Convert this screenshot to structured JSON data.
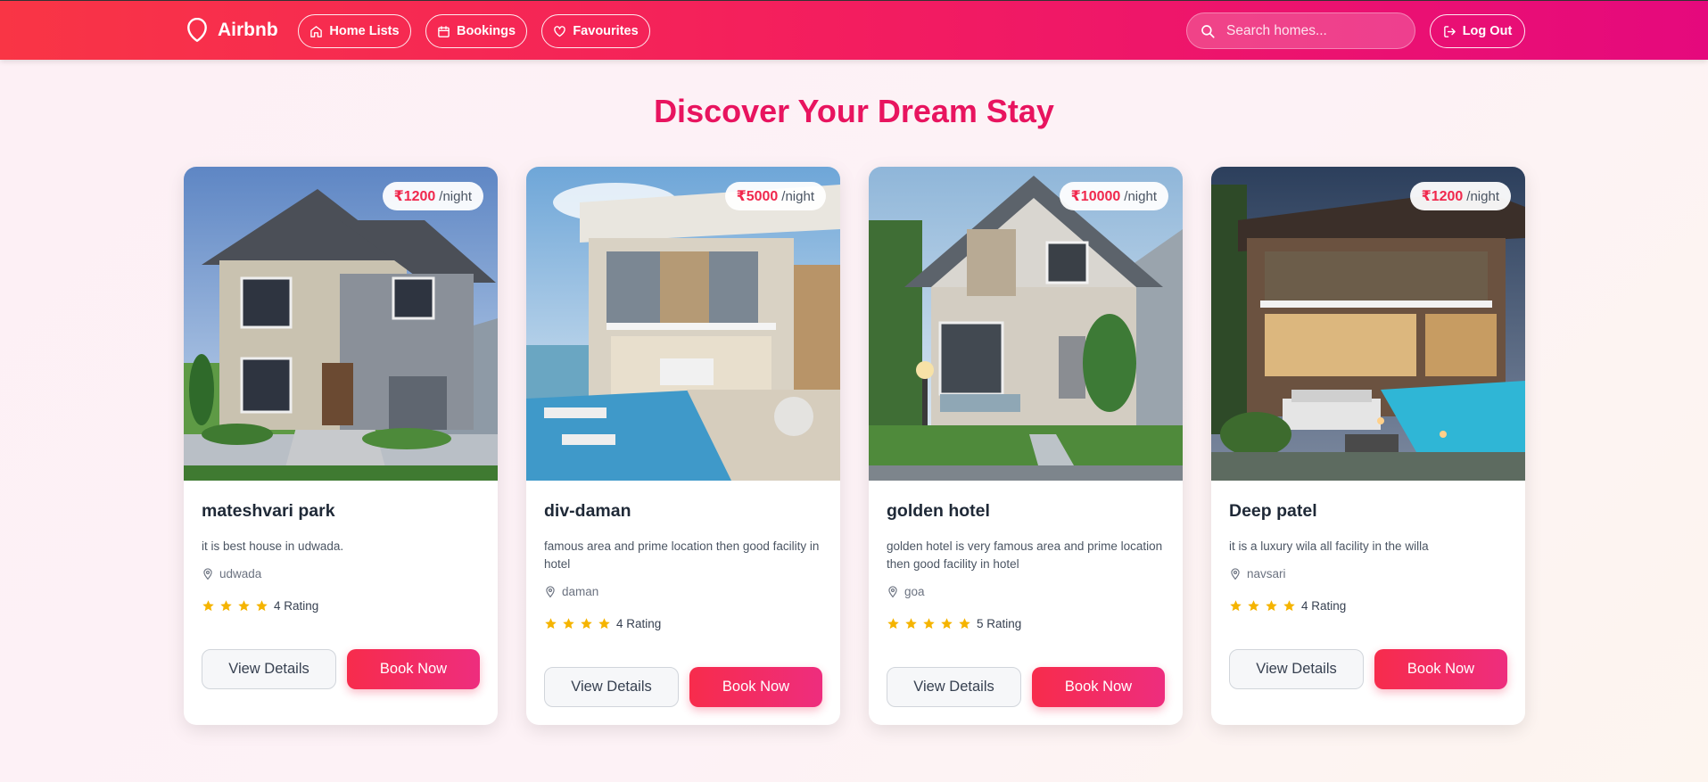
{
  "navbar": {
    "brand": "Airbnb",
    "home_lists": "Home Lists",
    "bookings": "Bookings",
    "favourites": "Favourites",
    "search_placeholder": "Search homes...",
    "logout": "Log Out"
  },
  "page_title": "Discover Your Dream Stay",
  "colors": {
    "accent": "#e8145f",
    "price": "#f0284d",
    "star": "#f5b400"
  },
  "cards": [
    {
      "price": "₹1200",
      "per": "/night",
      "title": "mateshvari park",
      "description": "it is best house in udwada.",
      "location": "udwada",
      "stars": 4,
      "rating_text": "4 Rating",
      "view": "View Details",
      "book": "Book Now"
    },
    {
      "price": "₹5000",
      "per": "/night",
      "title": "div-daman",
      "description": "famous area and prime location then good facility in hotel",
      "location": "daman",
      "stars": 4,
      "rating_text": "4 Rating",
      "view": "View Details",
      "book": "Book Now"
    },
    {
      "price": "₹10000",
      "per": "/night",
      "title": "golden hotel",
      "description": "golden hotel is very famous area and prime location then good facility in hotel",
      "location": "goa",
      "stars": 5,
      "rating_text": "5 Rating",
      "view": "View Details",
      "book": "Book Now"
    },
    {
      "price": "₹1200",
      "per": "/night",
      "title": "Deep patel",
      "description": "it is a luxury wila all facility in the willa",
      "location": "navsari",
      "stars": 4,
      "rating_text": "4 Rating",
      "view": "View Details",
      "book": "Book Now"
    }
  ]
}
